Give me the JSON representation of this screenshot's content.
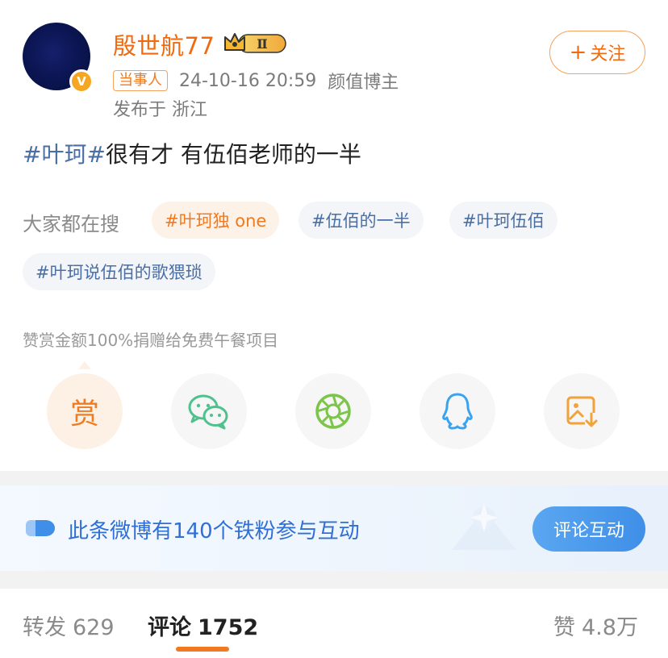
{
  "user": {
    "name": "殷世航77",
    "vip_level": "Ⅱ",
    "verified_badge": "V",
    "role_tag": "当事人",
    "timestamp": "24-10-16 20:59",
    "category": "颜值博主",
    "location": "发布于 浙江"
  },
  "follow": {
    "plus": "+",
    "label": "关注"
  },
  "post": {
    "hashtag": "#叶珂#",
    "text": "很有才 有伍佰老师的一半"
  },
  "search": {
    "label": "大家都在搜",
    "chips": [
      {
        "text": "#叶珂独 one",
        "hot": true
      },
      {
        "text": "#伍佰的一半",
        "hot": false
      },
      {
        "text": "#叶珂伍佰",
        "hot": false
      },
      {
        "text": "#叶珂说伍佰的歌猥琐",
        "hot": false
      }
    ]
  },
  "reward_note": "赞赏金额100%捐赠给免费午餐项目",
  "share": {
    "reward_glyph": "赏",
    "icons": [
      "reward-icon",
      "wechat-icon",
      "moments-icon",
      "qq-icon",
      "save-image-icon"
    ]
  },
  "fan_banner": {
    "text": "此条微博有140个铁粉参与互动",
    "button": "评论互动"
  },
  "stats": {
    "repost_label": "转发",
    "repost_count": "629",
    "comment_label": "评论",
    "comment_count": "1752",
    "like_label": "赞",
    "like_count": "4.8万"
  },
  "colors": {
    "accent_orange": "#f06a10",
    "hashtag_blue": "#4a6fa5",
    "banner_blue": "#2f6fd6"
  }
}
